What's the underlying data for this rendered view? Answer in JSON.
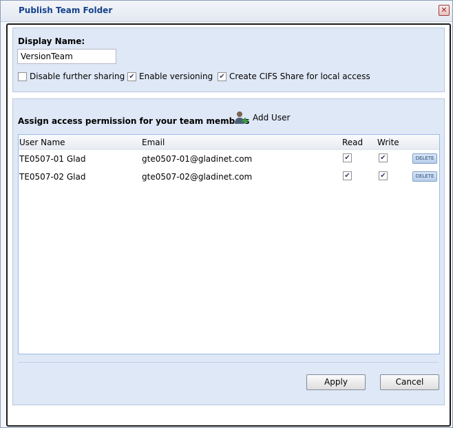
{
  "window": {
    "title": "Publish Team Folder",
    "close_symbol": "✕"
  },
  "settings": {
    "display_name_label": "Display Name:",
    "display_name_value": "VersionTeam",
    "options": [
      {
        "label": "Disable further sharing",
        "checked": false
      },
      {
        "label": "Enable versioning",
        "checked": true
      },
      {
        "label": "Create CIFS Share for local access",
        "checked": true
      }
    ]
  },
  "permissions": {
    "heading": "Assign access permission for your team members",
    "add_user_label": "Add User",
    "add_user_icon": "add-user-icon",
    "columns": [
      "User Name",
      "Email",
      "Read",
      "Write"
    ],
    "rows": [
      {
        "user": "TE0507-01 Glad",
        "email": "gte0507-01@gladinet.com",
        "read": true,
        "write": true,
        "delete_label": "DELETE"
      },
      {
        "user": "TE0507-02 Glad",
        "email": "gte0507-02@gladinet.com",
        "read": true,
        "write": true,
        "delete_label": "DELETE"
      }
    ]
  },
  "buttons": {
    "apply": "Apply",
    "cancel": "Cancel"
  },
  "colors": {
    "title_text": "#15428b",
    "panel_bg": "#dfe8f6",
    "grid_border": "#99bbe8"
  }
}
